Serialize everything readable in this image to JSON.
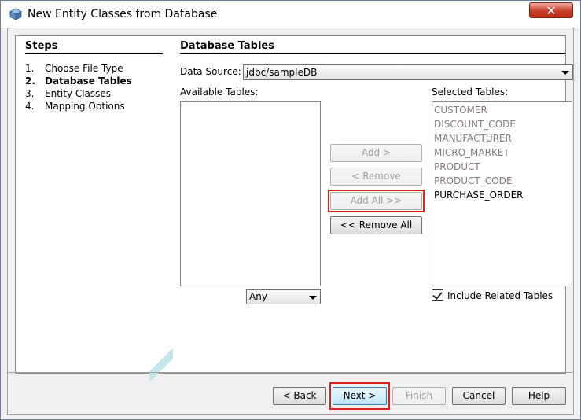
{
  "window": {
    "title": "New Entity Classes from Database",
    "close_label": "✕"
  },
  "steps": {
    "heading": "Steps",
    "items": [
      {
        "num": "1.",
        "label": "Choose File Type"
      },
      {
        "num": "2.",
        "label": "Database Tables"
      },
      {
        "num": "3.",
        "label": "Entity Classes"
      },
      {
        "num": "4.",
        "label": "Mapping Options"
      }
    ]
  },
  "main": {
    "heading": "Database Tables",
    "data_source_label": "Data Source:",
    "data_source_value": "jdbc/sampleDB",
    "available_label": "Available Tables:",
    "selected_label": "Selected Tables:",
    "selected_tables": [
      "CUSTOMER",
      "DISCOUNT_CODE",
      "MANUFACTURER",
      "MICRO_MARKET",
      "PRODUCT",
      "PRODUCT_CODE",
      "PURCHASE_ORDER"
    ],
    "filter_value": "Any",
    "include_related_label": "Include Related Tables",
    "include_related_checked": true
  },
  "transfer_buttons": {
    "add": "Add >",
    "remove": "< Remove",
    "add_all": "Add All >>",
    "remove_all": "<< Remove All"
  },
  "footer": {
    "back": "< Back",
    "next": "Next >",
    "finish": "Finish",
    "cancel": "Cancel",
    "help": "Help"
  },
  "colors": {
    "highlight": "#d9231f",
    "disabled_text": "#a0a0a0",
    "inactive_table": "#8a7a80"
  }
}
